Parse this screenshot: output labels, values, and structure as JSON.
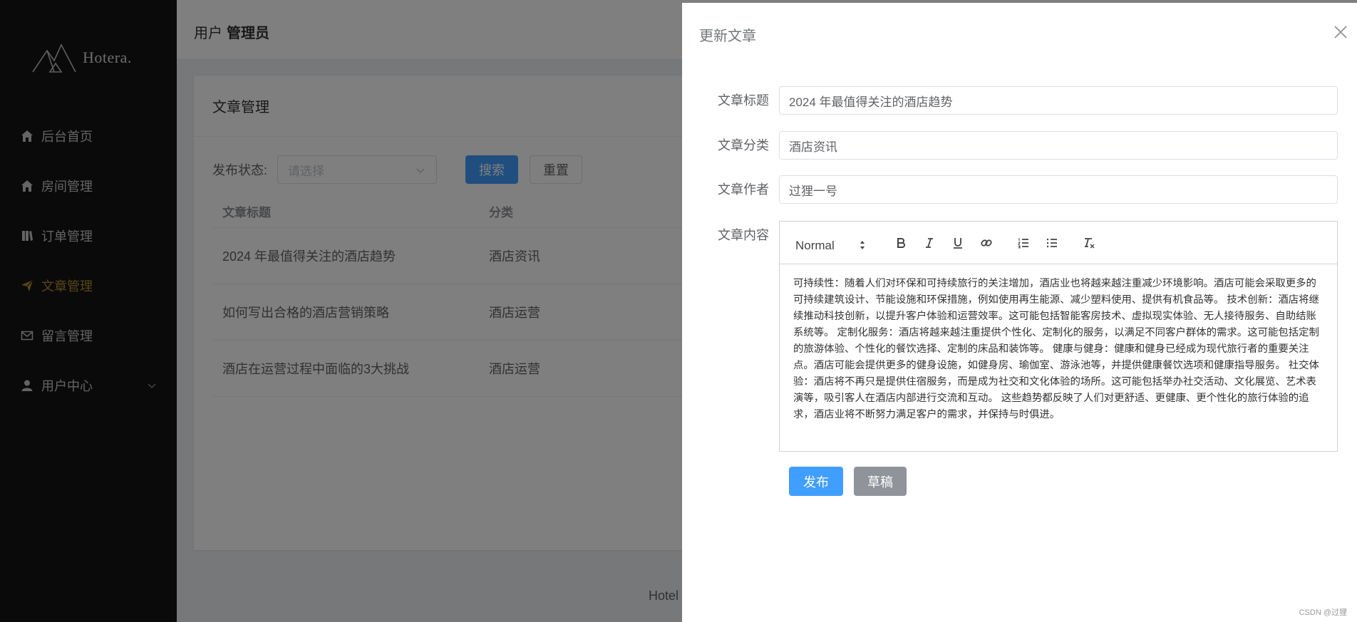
{
  "sidebar": {
    "logo_text": "Hotera.",
    "items": [
      {
        "label": "后台首页",
        "icon": "home-icon"
      },
      {
        "label": "房间管理",
        "icon": "home-icon"
      },
      {
        "label": "订单管理",
        "icon": "book-icon"
      },
      {
        "label": "文章管理",
        "icon": "paper-plane-icon",
        "active": true
      },
      {
        "label": "留言管理",
        "icon": "mail-icon"
      },
      {
        "label": "用户中心",
        "icon": "user-icon",
        "expandable": true
      }
    ],
    "active_color": "#b38b2d"
  },
  "header": {
    "user_prefix": "用户",
    "user_name": "管理员"
  },
  "page": {
    "title": "文章管理",
    "filter_label": "发布状态:",
    "status_placeholder": "请选择",
    "search_label": "搜索",
    "reset_label": "重置",
    "columns": [
      "文章标题",
      "分类"
    ],
    "rows": [
      {
        "title": "2024 年最值得关注的酒店趋势",
        "category": "酒店资讯"
      },
      {
        "title": "如何写出合格的酒店营销策略",
        "category": "酒店运营"
      },
      {
        "title": "酒店在运营过程中面临的3大挑战",
        "category": "酒店运营"
      }
    ],
    "footer_text": "Hotel"
  },
  "drawer": {
    "title": "更新文章",
    "fields": {
      "title_label": "文章标题",
      "title_value": "2024 年最值得关注的酒店趋势",
      "category_label": "文章分类",
      "category_value": "酒店资讯",
      "author_label": "文章作者",
      "author_value": "过狸一号",
      "content_label": "文章内容"
    },
    "editor": {
      "header_select": "Normal",
      "content": "可持续性：随着人们对环保和可持续旅行的关注增加，酒店业也将越来越注重减少环境影响。酒店可能会采取更多的可持续建筑设计、节能设施和环保措施，例如使用再生能源、减少塑料使用、提供有机食品等。 技术创新：酒店将继续推动科技创新，以提升客户体验和运营效率。这可能包括智能客房技术、虚拟现实体验、无人接待服务、自助结账系统等。 定制化服务：酒店将越来越注重提供个性化、定制化的服务，以满足不同客户群体的需求。这可能包括定制的旅游体验、个性化的餐饮选择、定制的床品和装饰等。 健康与健身：健康和健身已经成为现代旅行者的重要关注点。酒店可能会提供更多的健身设施，如健身房、瑜伽室、游泳池等，并提供健康餐饮选项和健康指导服务。 社交体验：酒店将不再只是提供住宿服务，而是成为社交和文化体验的场所。这可能包括举办社交活动、文化展览、艺术表演等，吸引客人在酒店内部进行交流和互动。 这些趋势都反映了人们对更舒适、更健康、更个性化的旅行体验的追求，酒店业将不断努力满足客户的需求，并保持与时俱进。"
    },
    "publish_label": "发布",
    "draft_label": "草稿"
  },
  "watermark": "CSDN @过狸"
}
